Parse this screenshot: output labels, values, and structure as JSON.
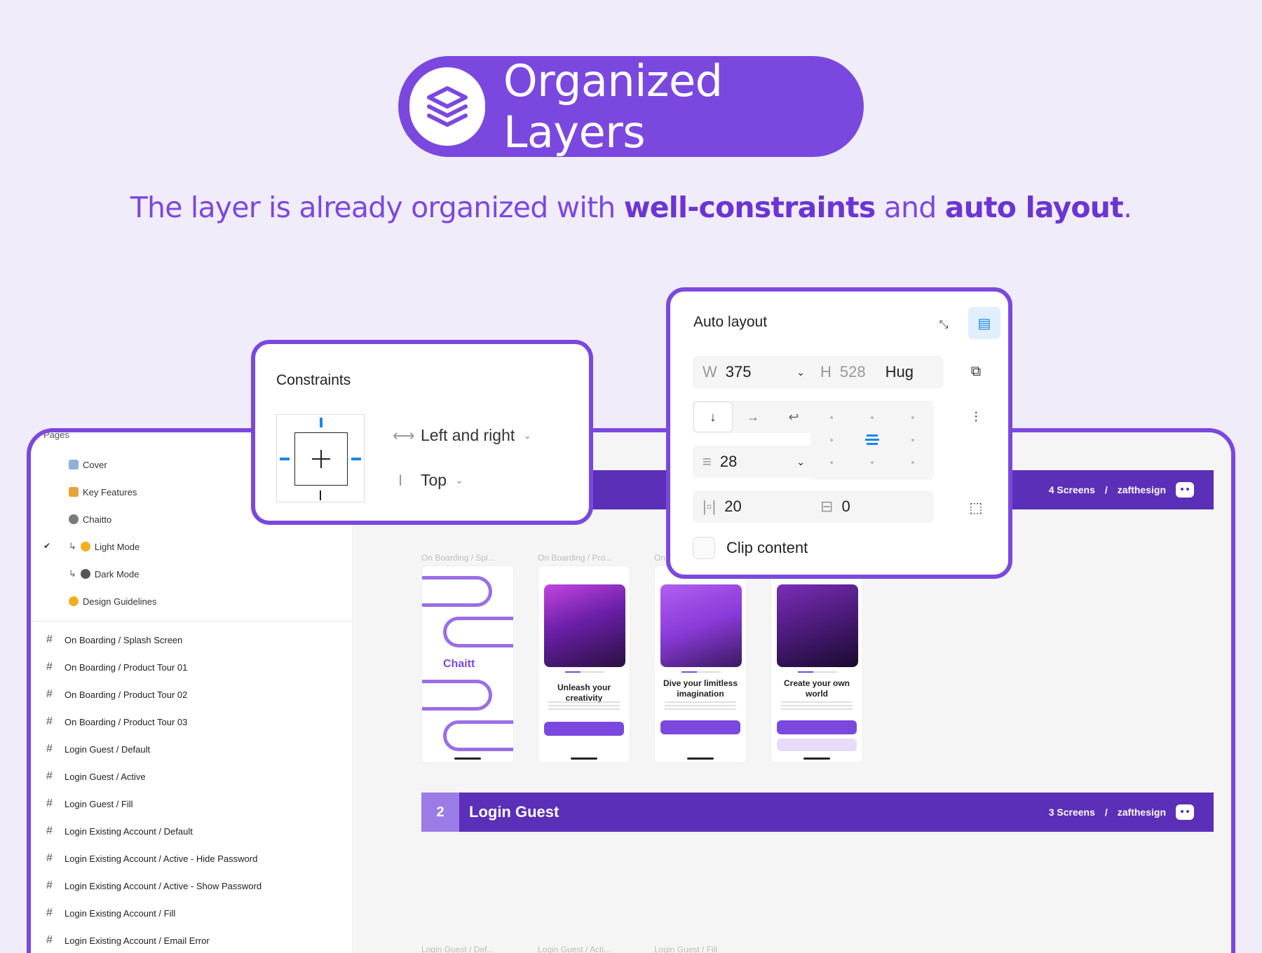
{
  "header": {
    "title": "Organized Layers",
    "subtitle_start": "The layer is already organized with ",
    "subtitle_bold1": "well-constraints",
    "subtitle_mid": " and ",
    "subtitle_bold2": "auto layout",
    "subtitle_end": "."
  },
  "layers": {
    "pages_label": "Pages",
    "pages": [
      {
        "label": "Cover"
      },
      {
        "label": "Key Features"
      },
      {
        "label": "Chaitto"
      },
      {
        "label": "Light Mode"
      },
      {
        "label": "Dark Mode"
      },
      {
        "label": "Design Guidelines"
      }
    ],
    "frames": [
      "On Boarding / Splash Screen",
      "On Boarding / Product Tour 01",
      "On Boarding / Product Tour 02",
      "On Boarding / Product Tour 03",
      "Login Guest / Default",
      "Login Guest / Active",
      "Login Guest / Fill",
      "Login Existing Account / Default",
      "Login Existing Account / Active - Hide Password",
      "Login Existing Account / Active - Show Password",
      "Login Existing Account / Fill",
      "Login Existing Account / Email Error"
    ]
  },
  "canvas": {
    "banner1": {
      "screens": "4 Screens",
      "sep": "/",
      "author": "zafthesign"
    },
    "banner2": {
      "number": "2",
      "title": "Login Guest",
      "screens": "3 Screens",
      "sep": "/",
      "author": "zafthesign"
    },
    "screen_labels": [
      "On Boarding / Spl...",
      "On Boarding / Pro...",
      "On"
    ],
    "screen_labels_bottom": [
      "Login Guest / Def...",
      "Login Guest / Acti...",
      "Login Guest / Fill"
    ],
    "splash_logo": "Chaitt",
    "phones": [
      {
        "heading": "Unleash your creativity"
      },
      {
        "heading": "Dive your limitless imagination"
      },
      {
        "heading": "Create your own world"
      }
    ]
  },
  "constraints": {
    "title": "Constraints",
    "horizontal": "Left and right",
    "vertical": "Top"
  },
  "auto_layout": {
    "title": "Auto layout",
    "w_label": "W",
    "w_value": "375",
    "h_label": "H",
    "h_value": "528",
    "h_mode": "Hug",
    "gap_value": "28",
    "padding_h": "20",
    "padding_v": "0",
    "clip_label": "Clip content"
  },
  "colors": {
    "accent": "#7b48df",
    "banner": "#5b2fb8",
    "background": "#f1ecfa"
  }
}
